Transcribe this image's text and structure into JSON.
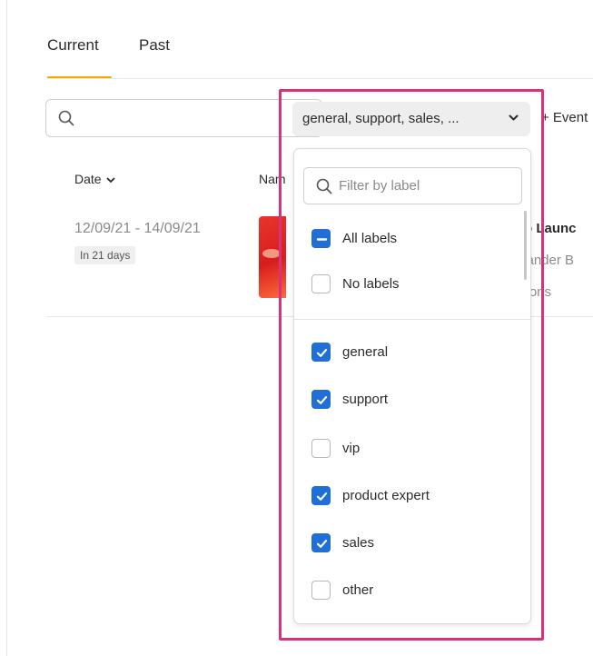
{
  "tabs": [
    {
      "label": "Current",
      "active": true
    },
    {
      "label": "Past",
      "active": false
    }
  ],
  "search": {
    "value": "",
    "placeholder": ""
  },
  "label_filter": {
    "selected_text": "general, support, sales, ...",
    "filter_placeholder": "Filter by label",
    "bulk_options": [
      {
        "label": "All labels",
        "state": "mixed"
      },
      {
        "label": "No labels",
        "state": "unchecked"
      }
    ],
    "labels": [
      {
        "label": "general",
        "checked": true
      },
      {
        "label": "support",
        "checked": true
      },
      {
        "label": "vip",
        "checked": false
      },
      {
        "label": "product expert",
        "checked": true
      },
      {
        "label": "sales",
        "checked": true
      },
      {
        "label": "other",
        "checked": false
      }
    ]
  },
  "events_link": "+ Event",
  "table": {
    "columns": [
      "Date",
      "Nam"
    ],
    "rows": [
      {
        "date": "12/09/21 - 14/09/21",
        "badge": "In 21 days",
        "title": "to Launc",
        "subtitle1": "xander B",
        "subtitle2": "sions"
      }
    ]
  },
  "colors": {
    "accent_underline": "#f5a800",
    "checkbox_blue": "#1f6fd6",
    "highlight_frame": "#d6337a"
  },
  "icons": [
    "search-icon",
    "chevron-down-icon",
    "checkmark-icon",
    "minus-icon"
  ]
}
